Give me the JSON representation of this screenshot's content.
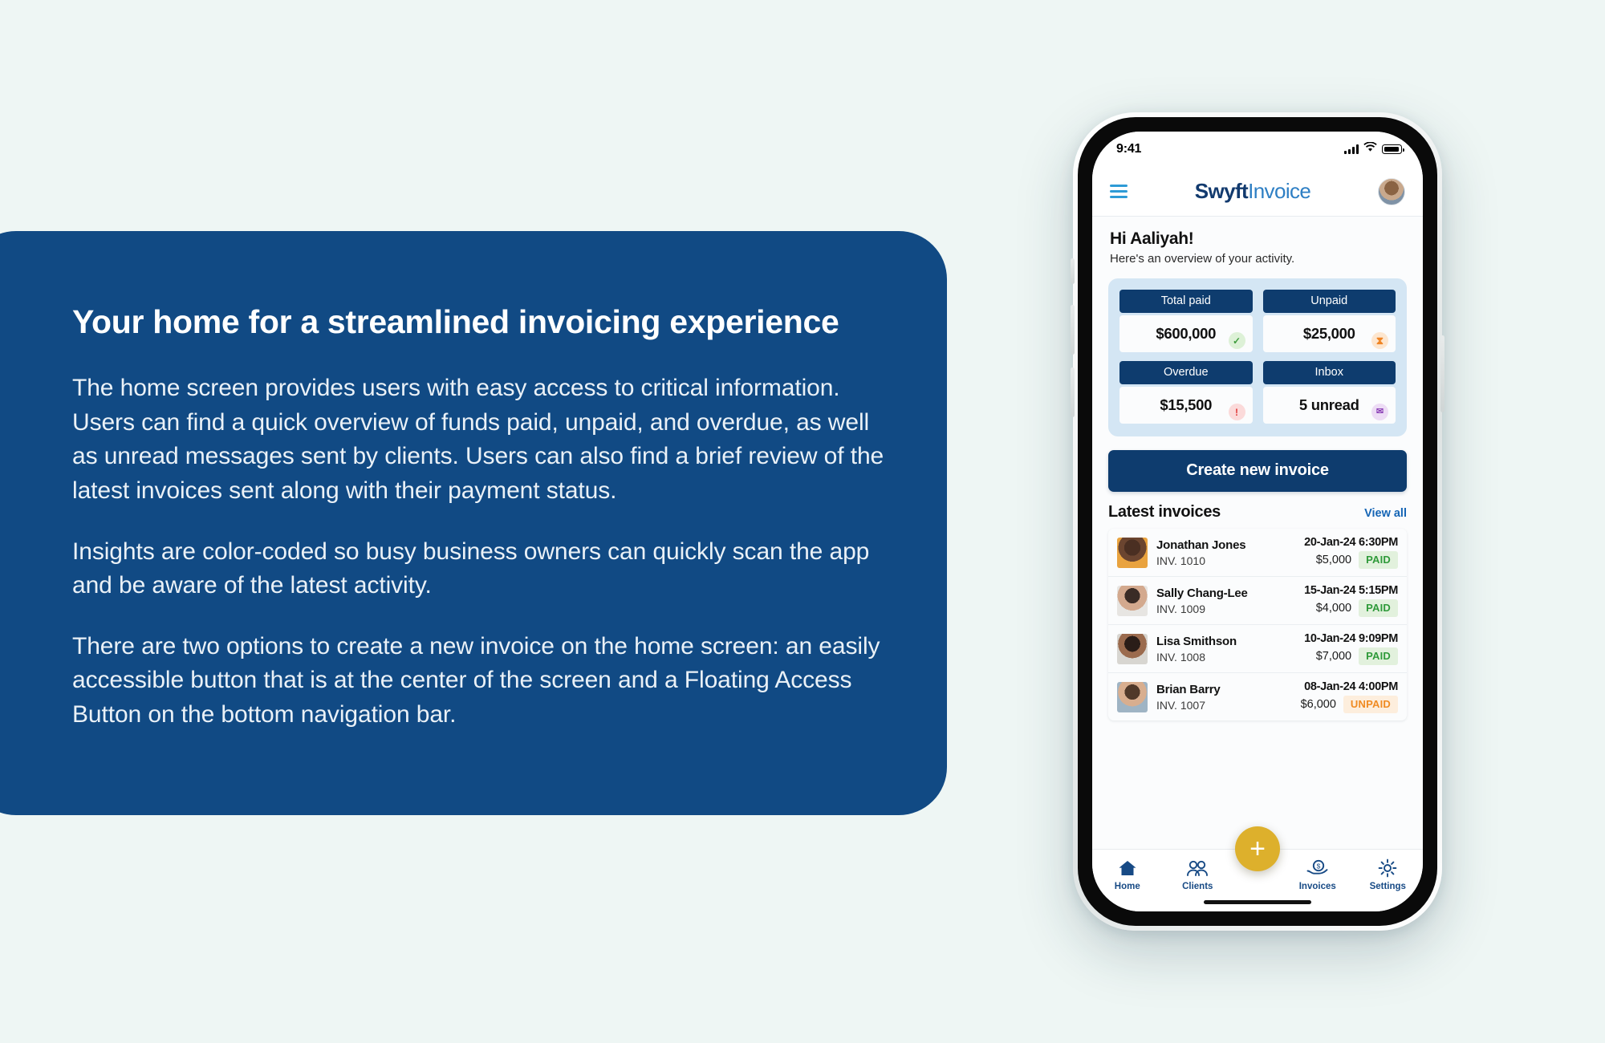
{
  "page": {
    "background_color": "#eef6f4"
  },
  "info_panel": {
    "background_color": "#114a84",
    "title": "Your home for a streamlined invoicing experience",
    "paragraphs": [
      "The home screen provides users with easy access to critical information. Users can find a quick overview of funds paid, unpaid, and overdue, as well as unread messages sent by clients. Users can also find a brief review of the latest invoices sent along with their payment status.",
      "Insights are color-coded so busy business owners can quickly scan the app and be aware of the latest activity.",
      "There are two options to create a new invoice on the home screen: an easily accessible button that is at the center of the screen and a Floating Access Button on the bottom navigation bar."
    ]
  },
  "phone": {
    "status_bar": {
      "time": "9:41",
      "cellular_icon": "signal-bars-icon",
      "wifi_icon": "wifi-icon",
      "battery_icon": "battery-icon"
    },
    "app_header": {
      "menu_icon": "hamburger-menu-icon",
      "brand_first": "Swyft",
      "brand_second": "Invoice",
      "brand_color_primary": "#123a6e",
      "brand_color_secondary": "#2e7fc4",
      "avatar_icon": "user-avatar"
    },
    "greeting": {
      "heading": "Hi Aaliyah!",
      "subheading": "Here's an overview of your activity."
    },
    "stats": {
      "panel_color": "#d4e6f4",
      "header_color": "#0e3c6e",
      "items": [
        {
          "label": "Total paid",
          "value": "$600,000",
          "icon": "check-circle-icon",
          "icon_glyph": "✓",
          "icon_class": "ico-check",
          "accent": "#3e9c3e"
        },
        {
          "label": "Unpaid",
          "value": "$25,000",
          "icon": "hourglass-icon",
          "icon_glyph": "⧗",
          "icon_class": "ico-hour",
          "accent": "#ef8424"
        },
        {
          "label": "Overdue",
          "value": "$15,500",
          "icon": "exclamation-icon",
          "icon_glyph": "!",
          "icon_class": "ico-alert",
          "accent": "#e03838"
        },
        {
          "label": "Inbox",
          "value": "5 unread",
          "icon": "envelope-icon",
          "icon_glyph": "✉",
          "icon_class": "ico-mail",
          "accent": "#8a3fb5"
        }
      ]
    },
    "create_button": {
      "label": "Create new invoice",
      "color": "#0e3c6e"
    },
    "latest_invoices": {
      "title": "Latest invoices",
      "view_all_label": "View all",
      "view_all_color": "#1565b5",
      "rows": [
        {
          "name": "Jonathan Jones",
          "invoice": "INV. 1010",
          "date": "20-Jan-24 6:30PM",
          "amount": "$5,000",
          "status": "PAID",
          "status_class": "badge-paid",
          "avatar_class": "av-a"
        },
        {
          "name": "Sally Chang-Lee",
          "invoice": "INV. 1009",
          "date": "15-Jan-24 5:15PM",
          "amount": "$4,000",
          "status": "PAID",
          "status_class": "badge-paid",
          "avatar_class": "av-b"
        },
        {
          "name": "Lisa Smithson",
          "invoice": "INV. 1008",
          "date": "10-Jan-24 9:09PM",
          "amount": "$7,000",
          "status": "PAID",
          "status_class": "badge-paid",
          "avatar_class": "av-c"
        },
        {
          "name": "Brian Barry",
          "invoice": "INV. 1007",
          "date": "08-Jan-24 4:00PM",
          "amount": "$6,000",
          "status": "UNPAID",
          "status_class": "badge-unpaid",
          "avatar_class": "av-d"
        }
      ]
    },
    "floating_action_button": {
      "label": "+",
      "color": "#ddb02c",
      "icon": "plus-icon"
    },
    "bottom_nav": {
      "label_color": "#174a85",
      "items": [
        {
          "label": "Home",
          "icon": "home-icon",
          "active": true
        },
        {
          "label": "Clients",
          "icon": "people-icon",
          "active": false
        },
        {
          "label": "Invoices",
          "icon": "hand-money-icon",
          "active": false
        },
        {
          "label": "Settings",
          "icon": "gear-icon",
          "active": false
        }
      ]
    }
  }
}
